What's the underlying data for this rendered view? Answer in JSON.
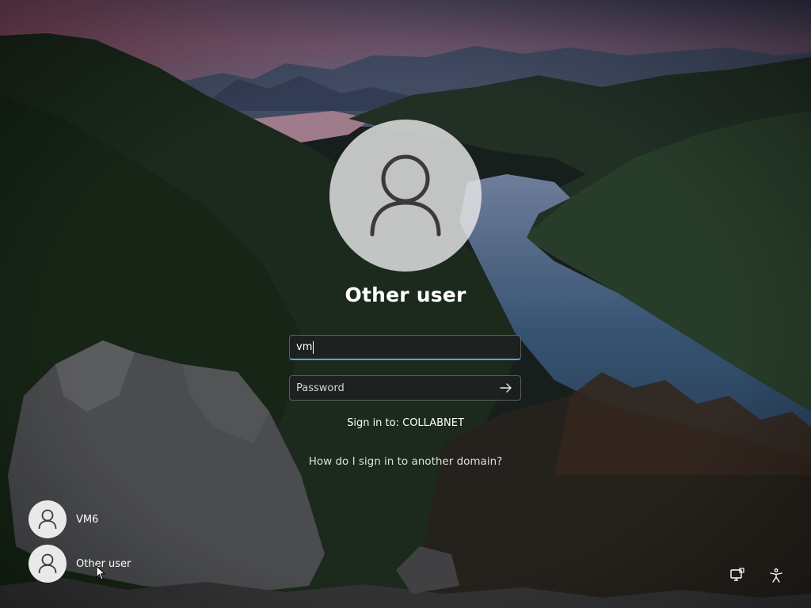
{
  "login": {
    "display_name": "Other user",
    "username_value": "vm",
    "password_placeholder": "Password",
    "sign_in_to": "Sign in to: COLLABNET",
    "domain_help_link": "How do I sign in to another domain?"
  },
  "user_list": [
    {
      "label": "VM6",
      "icon": "user-icon"
    },
    {
      "label": "Other user",
      "icon": "user-icon"
    }
  ],
  "corner_icons": [
    "network-icon",
    "accessibility-icon"
  ],
  "colors": {
    "focus_accent": "#4ea4ee",
    "avatar_bg": "#e8e8e8"
  }
}
